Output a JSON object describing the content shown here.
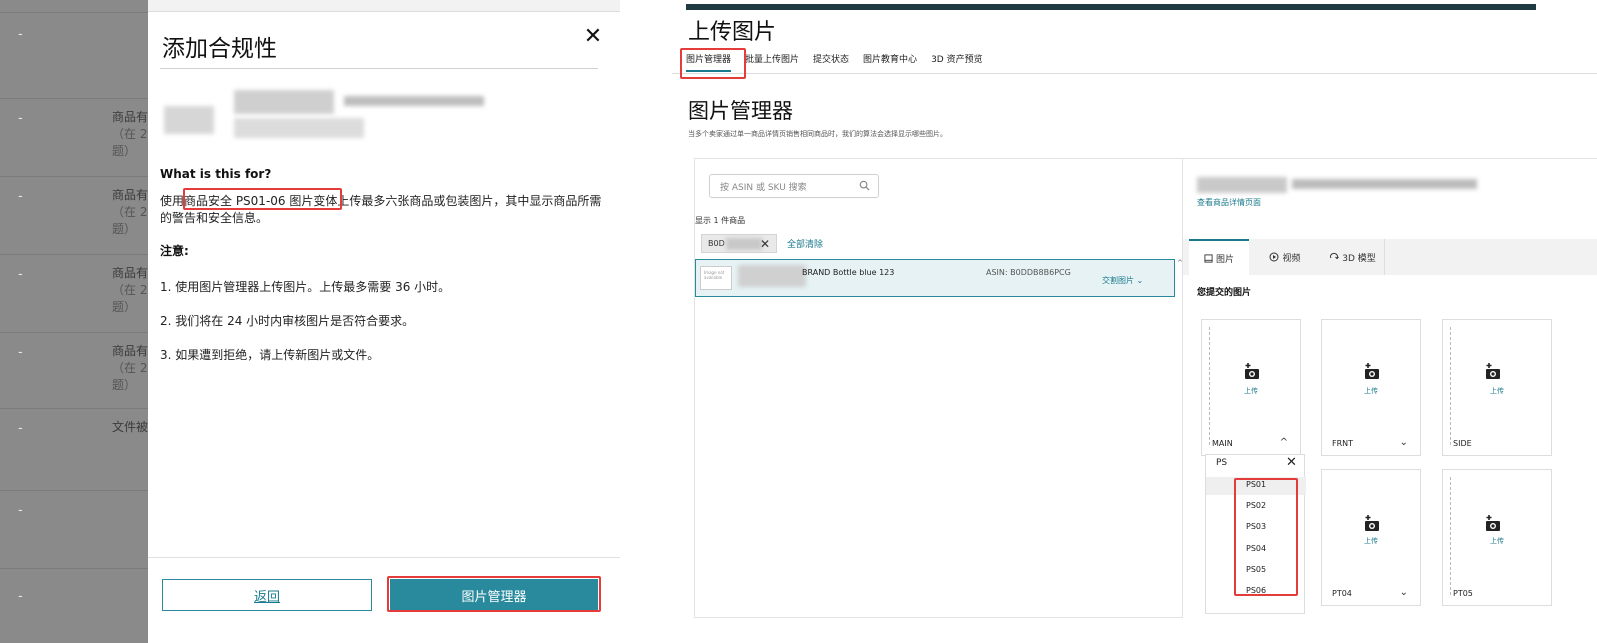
{
  "left": {
    "background_rows": [
      {
        "dash": "-",
        "text": "",
        "sub1": "",
        "sub2": ""
      },
      {
        "dash": "-",
        "text": "商品有",
        "sub1": "（在 2",
        "sub2": "题）"
      },
      {
        "dash": "-",
        "text": "商品有",
        "sub1": "（在 2",
        "sub2": "题）"
      },
      {
        "dash": "-",
        "text": "商品有",
        "sub1": "（在 2",
        "sub2": "题）"
      },
      {
        "dash": "-",
        "text": "商品有",
        "sub1": "（在 2",
        "sub2": "题）"
      },
      {
        "dash": "-",
        "text": "文件被",
        "sub1": "",
        "sub2": ""
      },
      {
        "dash": "-",
        "text": "",
        "sub1": "",
        "sub2": ""
      },
      {
        "dash": "-",
        "text": "",
        "sub1": "",
        "sub2": ""
      }
    ],
    "modal": {
      "title": "添加合规性",
      "close_glyph": "✕",
      "what_title": "What is this for?",
      "description": "使用商品安全 PS01-06 图片变体上传最多六张商品或包装图片，其中显示商品所需的警告和安全信息。",
      "note_title": "注意:",
      "notes": [
        "1. 使用图片管理器上传图片。上传最多需要 36 小时。",
        "2. 我们将在 24 小时内审核图片是否符合要求。",
        "3. 如果遭到拒绝，请上传新图片或文件。"
      ],
      "back_label": "返回",
      "image_manager_label": "图片管理器"
    }
  },
  "right": {
    "page_title": "上传图片",
    "tabs": [
      "图片管理器",
      "批量上传图片",
      "提交状态",
      "图片教育中心",
      "3D 资产预览"
    ],
    "section_title": "图片管理器",
    "section_desc": "当多个卖家通过单一商品详情页销售相同商品时，我们的算法会选择显示哪些图片。",
    "search_placeholder": "按 ASIN 或 SKU 搜索",
    "showing": "显示 1 件商品",
    "chip_text": "B0D",
    "chip_close": "✕",
    "clear_all": "全部清除",
    "product": {
      "thumb_text": "Image not available",
      "name": "BRAND Bottle blue 123",
      "asin": "ASIN: B0DDB8B6PCG",
      "link": "交割图片 ⌄"
    },
    "detail": {
      "link": "查看商品详情页面",
      "media_tabs": [
        "图片",
        "视频",
        "3D 模型"
      ],
      "submitted_title": "您提交的图片"
    },
    "slots": [
      {
        "label": "MAIN",
        "chevron": "^",
        "upload": "上传"
      },
      {
        "label": "FRNT",
        "chevron": "⌄",
        "upload": "上传"
      },
      {
        "label": "SIDE",
        "chevron": "",
        "upload": "上传"
      },
      {
        "label": "",
        "chevron": "",
        "upload": ""
      },
      {
        "label": "PT04",
        "chevron": "⌄",
        "upload": "上传"
      },
      {
        "label": "PT05",
        "chevron": "",
        "upload": "上传"
      }
    ],
    "dropdown": {
      "input": "PS",
      "close": "✕",
      "options": [
        "PS01",
        "PS02",
        "PS03",
        "PS04",
        "PS05",
        "PS06"
      ]
    }
  },
  "colors": {
    "accent": "#2a8a9d",
    "link": "#1a7a8d",
    "highlight_box": "#e43b3b",
    "overlay_bg": "#8a8a8a",
    "top_bar": "#1f3a40"
  }
}
